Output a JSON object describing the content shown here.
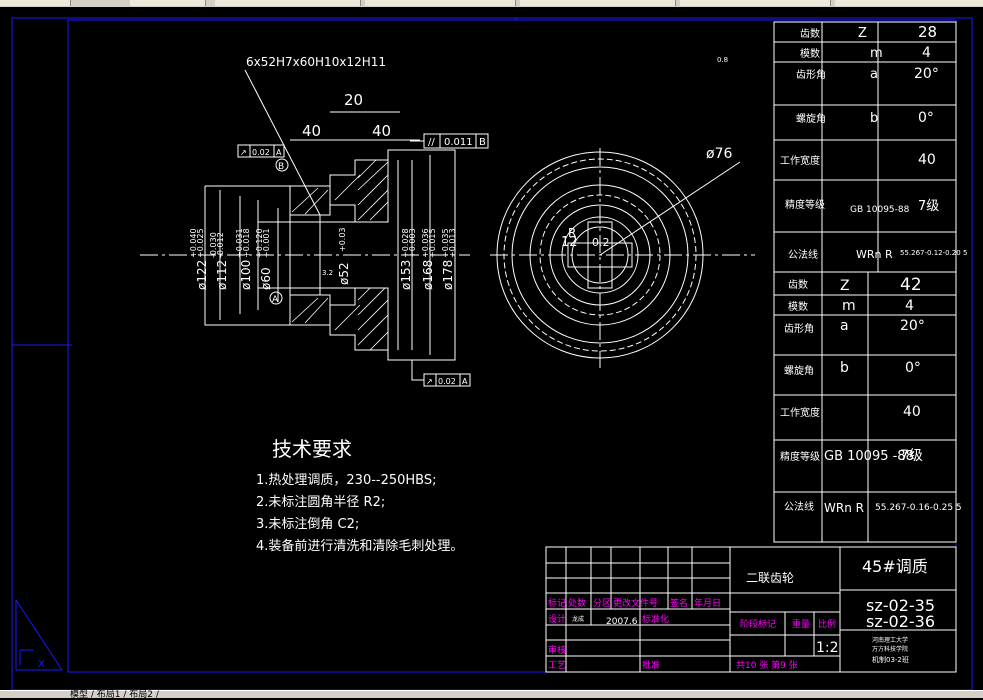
{
  "drawing": {
    "spline_spec": "6x52H7x60H10x12H11",
    "dims_top": {
      "width_center": "20",
      "left_40": "40",
      "right_40": "40"
    },
    "tol_frame_top": {
      "sym": "//",
      "value": "0.011",
      "datum": "B"
    },
    "tol_frame_left": {
      "sym": "↗",
      "value": "0.02",
      "datum": "A"
    },
    "tol_frame_bottom": {
      "sym": "↗",
      "value": "0.02",
      "datum": "A"
    },
    "datum_labels": {
      "a": "A",
      "b": "B"
    },
    "roughness_top": "0.8",
    "roughness_inner": "3.2",
    "diameters": [
      {
        "text": "ø122",
        "tol_up": "+0.040",
        "tol_dn": "+0.025"
      },
      {
        "text": "ø112",
        "tol_up": "-0.030",
        "tol_dn": "-0.012"
      },
      {
        "text": "ø100",
        "tol_up": "+0.031",
        "tol_dn": "+0.018"
      },
      {
        "text": "ø60",
        "tol_up": "+0.120",
        "tol_dn": "+0.001"
      },
      {
        "text": "ø52",
        "tol_up": "+0.03",
        "tol_dn": "0"
      },
      {
        "text": "ø153",
        "tol_up": "+0.028",
        "tol_dn": "+0.003"
      },
      {
        "text": "ø168",
        "tol_up": "+0.036",
        "tol_dn": "+0.015"
      },
      {
        "text": "ø178",
        "tol_up": "+0.035",
        "tol_dn": "+0.013"
      }
    ],
    "side_view": {
      "dia_label": "ø76",
      "r_label": "R",
      "spline_label": "12",
      "hole_label": "0.2"
    }
  },
  "tech_req": {
    "title": "技术要求",
    "items": [
      "1.热处理调质，230--250HBS;",
      "2.未标注圆角半径 R2;",
      "3.未标注倒角 C2;",
      "4.装备前进行清洗和清除毛刺处理。"
    ]
  },
  "gear_table_1": [
    {
      "label": "齿数",
      "sym": "Z",
      "val": "28"
    },
    {
      "label": "模数",
      "sym": "m",
      "val": "4"
    },
    {
      "label": "齿形角",
      "sym": "a",
      "val": "20°"
    },
    {
      "label": "螺旋角",
      "sym": "b",
      "val": "0°"
    },
    {
      "label": "工作宽度",
      "sym": "",
      "val": "40"
    },
    {
      "label": "精度等级",
      "sym": "GB 10095-88",
      "val": "7级"
    },
    {
      "label": "公法线",
      "sym": "WRn R",
      "val": "55.267-0.12-0.20 5"
    }
  ],
  "gear_table_2": [
    {
      "label": "齿数",
      "sym": "Z",
      "val": "42"
    },
    {
      "label": "模数",
      "sym": "m",
      "val": "4"
    },
    {
      "label": "齿形角",
      "sym": "a",
      "val": "20°"
    },
    {
      "label": "螺旋角",
      "sym": "b",
      "val": "0°"
    },
    {
      "label": "工作宽度",
      "sym": "",
      "val": "40"
    },
    {
      "label": "精度等级",
      "sym": "GB 10095 -88",
      "val": "7级"
    },
    {
      "label": "公法线",
      "sym": "WRn R",
      "val": "55.267-0.16-0.25 5"
    }
  ],
  "title_block": {
    "part_name": "二联齿轮",
    "material": "45#调质",
    "drawing_no_1": "sz-02-35",
    "drawing_no_2": "sz-02-36",
    "scale": "1:2",
    "school_1": "河南理工大学",
    "school_2": "万方科技学院",
    "class": "机制03-2班",
    "sheets": "共10 张 第9 张",
    "date": "2007.6",
    "row_labels": [
      "标记",
      "处数",
      "分区",
      "更改文件号",
      "签名",
      "年月日"
    ],
    "design": "设计",
    "designer": "龙成",
    "standard": "标准化",
    "stage_mark": "阶段标记",
    "weight": "重量",
    "ratio": "比例",
    "check": "审核",
    "process": "工艺",
    "approve": "批准"
  },
  "statusbar": {
    "text": "模型 / 布局1 / 布局2 /"
  },
  "colors": {
    "line": "#ffffff",
    "border": "#1a1aff",
    "magenta": "#ff00ff",
    "red": "#ff3030",
    "bg": "#000000"
  }
}
